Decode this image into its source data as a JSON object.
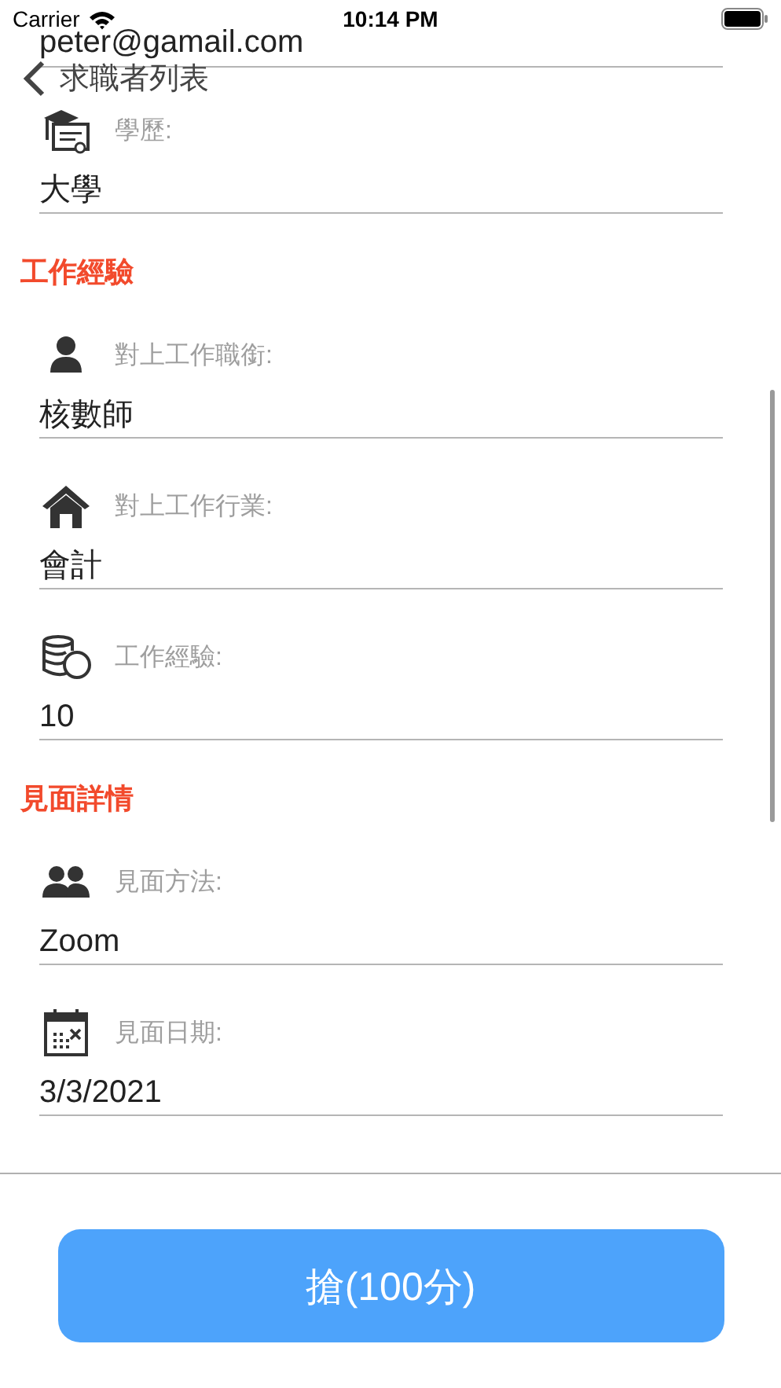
{
  "status_bar": {
    "carrier": "Carrier",
    "time": "10:14 PM"
  },
  "nav_bar": {
    "back_label": "求職者列表"
  },
  "form": {
    "partial_field": {
      "value": "peter@gamail.com"
    },
    "fields": [
      {
        "kind": "education",
        "label": "學歷:",
        "value": "大學"
      }
    ],
    "sections": [
      {
        "title": "工作經驗",
        "fields": [
          {
            "kind": "person",
            "label": "對上工作職銜:",
            "value": "核數師"
          },
          {
            "kind": "house",
            "label": "對上工作行業:",
            "value": "會計"
          },
          {
            "kind": "coins",
            "label": "工作經驗:",
            "value": "10"
          }
        ]
      },
      {
        "title": "見面詳情",
        "fields": [
          {
            "kind": "people",
            "label": "見面方法:",
            "value": "Zoom"
          },
          {
            "kind": "calendar",
            "label": "見面日期:",
            "value": "3/3/2021"
          }
        ]
      }
    ]
  },
  "action_button": {
    "label": "搶(100分)"
  }
}
